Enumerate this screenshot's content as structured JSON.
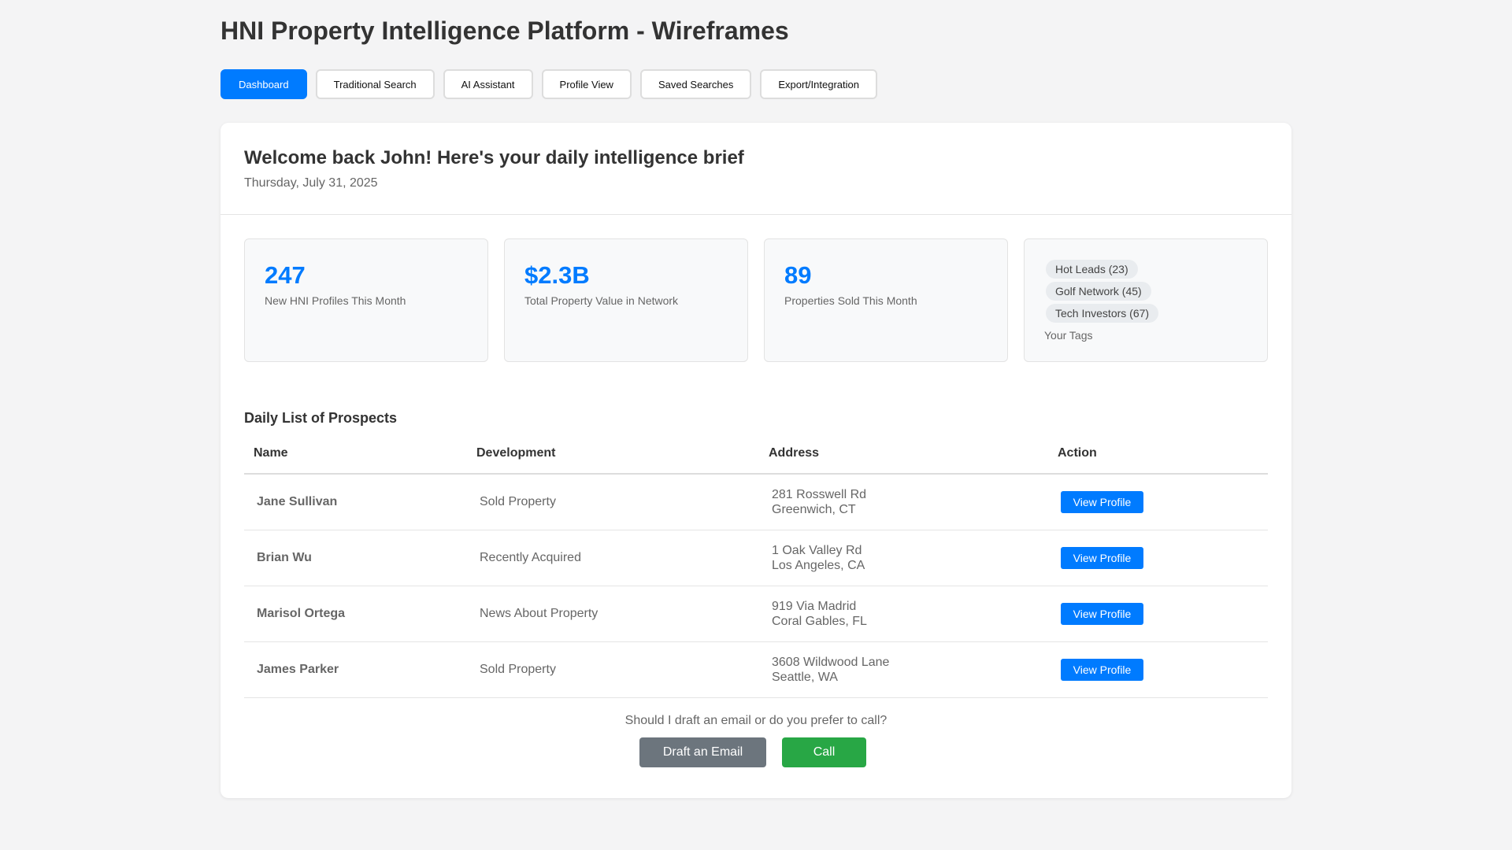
{
  "page": {
    "title": "HNI Property Intelligence Platform - Wireframes"
  },
  "tabs": [
    {
      "label": "Dashboard",
      "active": true
    },
    {
      "label": "Traditional Search",
      "active": false
    },
    {
      "label": "AI Assistant",
      "active": false
    },
    {
      "label": "Profile View",
      "active": false
    },
    {
      "label": "Saved Searches",
      "active": false
    },
    {
      "label": "Export/Integration",
      "active": false
    }
  ],
  "brief": {
    "welcome": "Welcome back John! Here's your daily intelligence brief",
    "date": "Thursday, July 31, 2025"
  },
  "stats": [
    {
      "value": "247",
      "label": "New HNI Profiles This Month"
    },
    {
      "value": "$2.3B",
      "label": "Total Property Value in Network"
    },
    {
      "value": "89",
      "label": "Properties Sold This Month"
    }
  ],
  "tags": {
    "items": [
      "Hot Leads (23)",
      "Golf Network (45)",
      "Tech Investors (67)"
    ],
    "label": "Your Tags"
  },
  "prospects": {
    "title": "Daily List of Prospects",
    "columns": [
      "Name",
      "Development",
      "Address",
      "Action"
    ],
    "rows": [
      {
        "name": "Jane Sullivan",
        "development": "Sold Property",
        "address_line1": "281 Rosswell Rd",
        "address_line2": "Greenwich, CT",
        "action": "View Profile"
      },
      {
        "name": "Brian Wu",
        "development": "Recently Acquired",
        "address_line1": "1 Oak Valley Rd",
        "address_line2": "Los Angeles, CA",
        "action": "View Profile"
      },
      {
        "name": "Marisol Ortega",
        "development": "News About Property",
        "address_line1": "919 Via Madrid",
        "address_line2": "Coral Gables, FL",
        "action": "View Profile"
      },
      {
        "name": "James Parker",
        "development": "Sold Property",
        "address_line1": "3608 Wildwood Lane",
        "address_line2": "Seattle, WA",
        "action": "View Profile"
      }
    ]
  },
  "followup": {
    "prompt": "Should I draft an email or do you prefer to call?",
    "email_label": "Draft an Email",
    "call_label": "Call"
  },
  "colors": {
    "primary": "#007bff",
    "secondary": "#6c757d",
    "success": "#28a745"
  }
}
